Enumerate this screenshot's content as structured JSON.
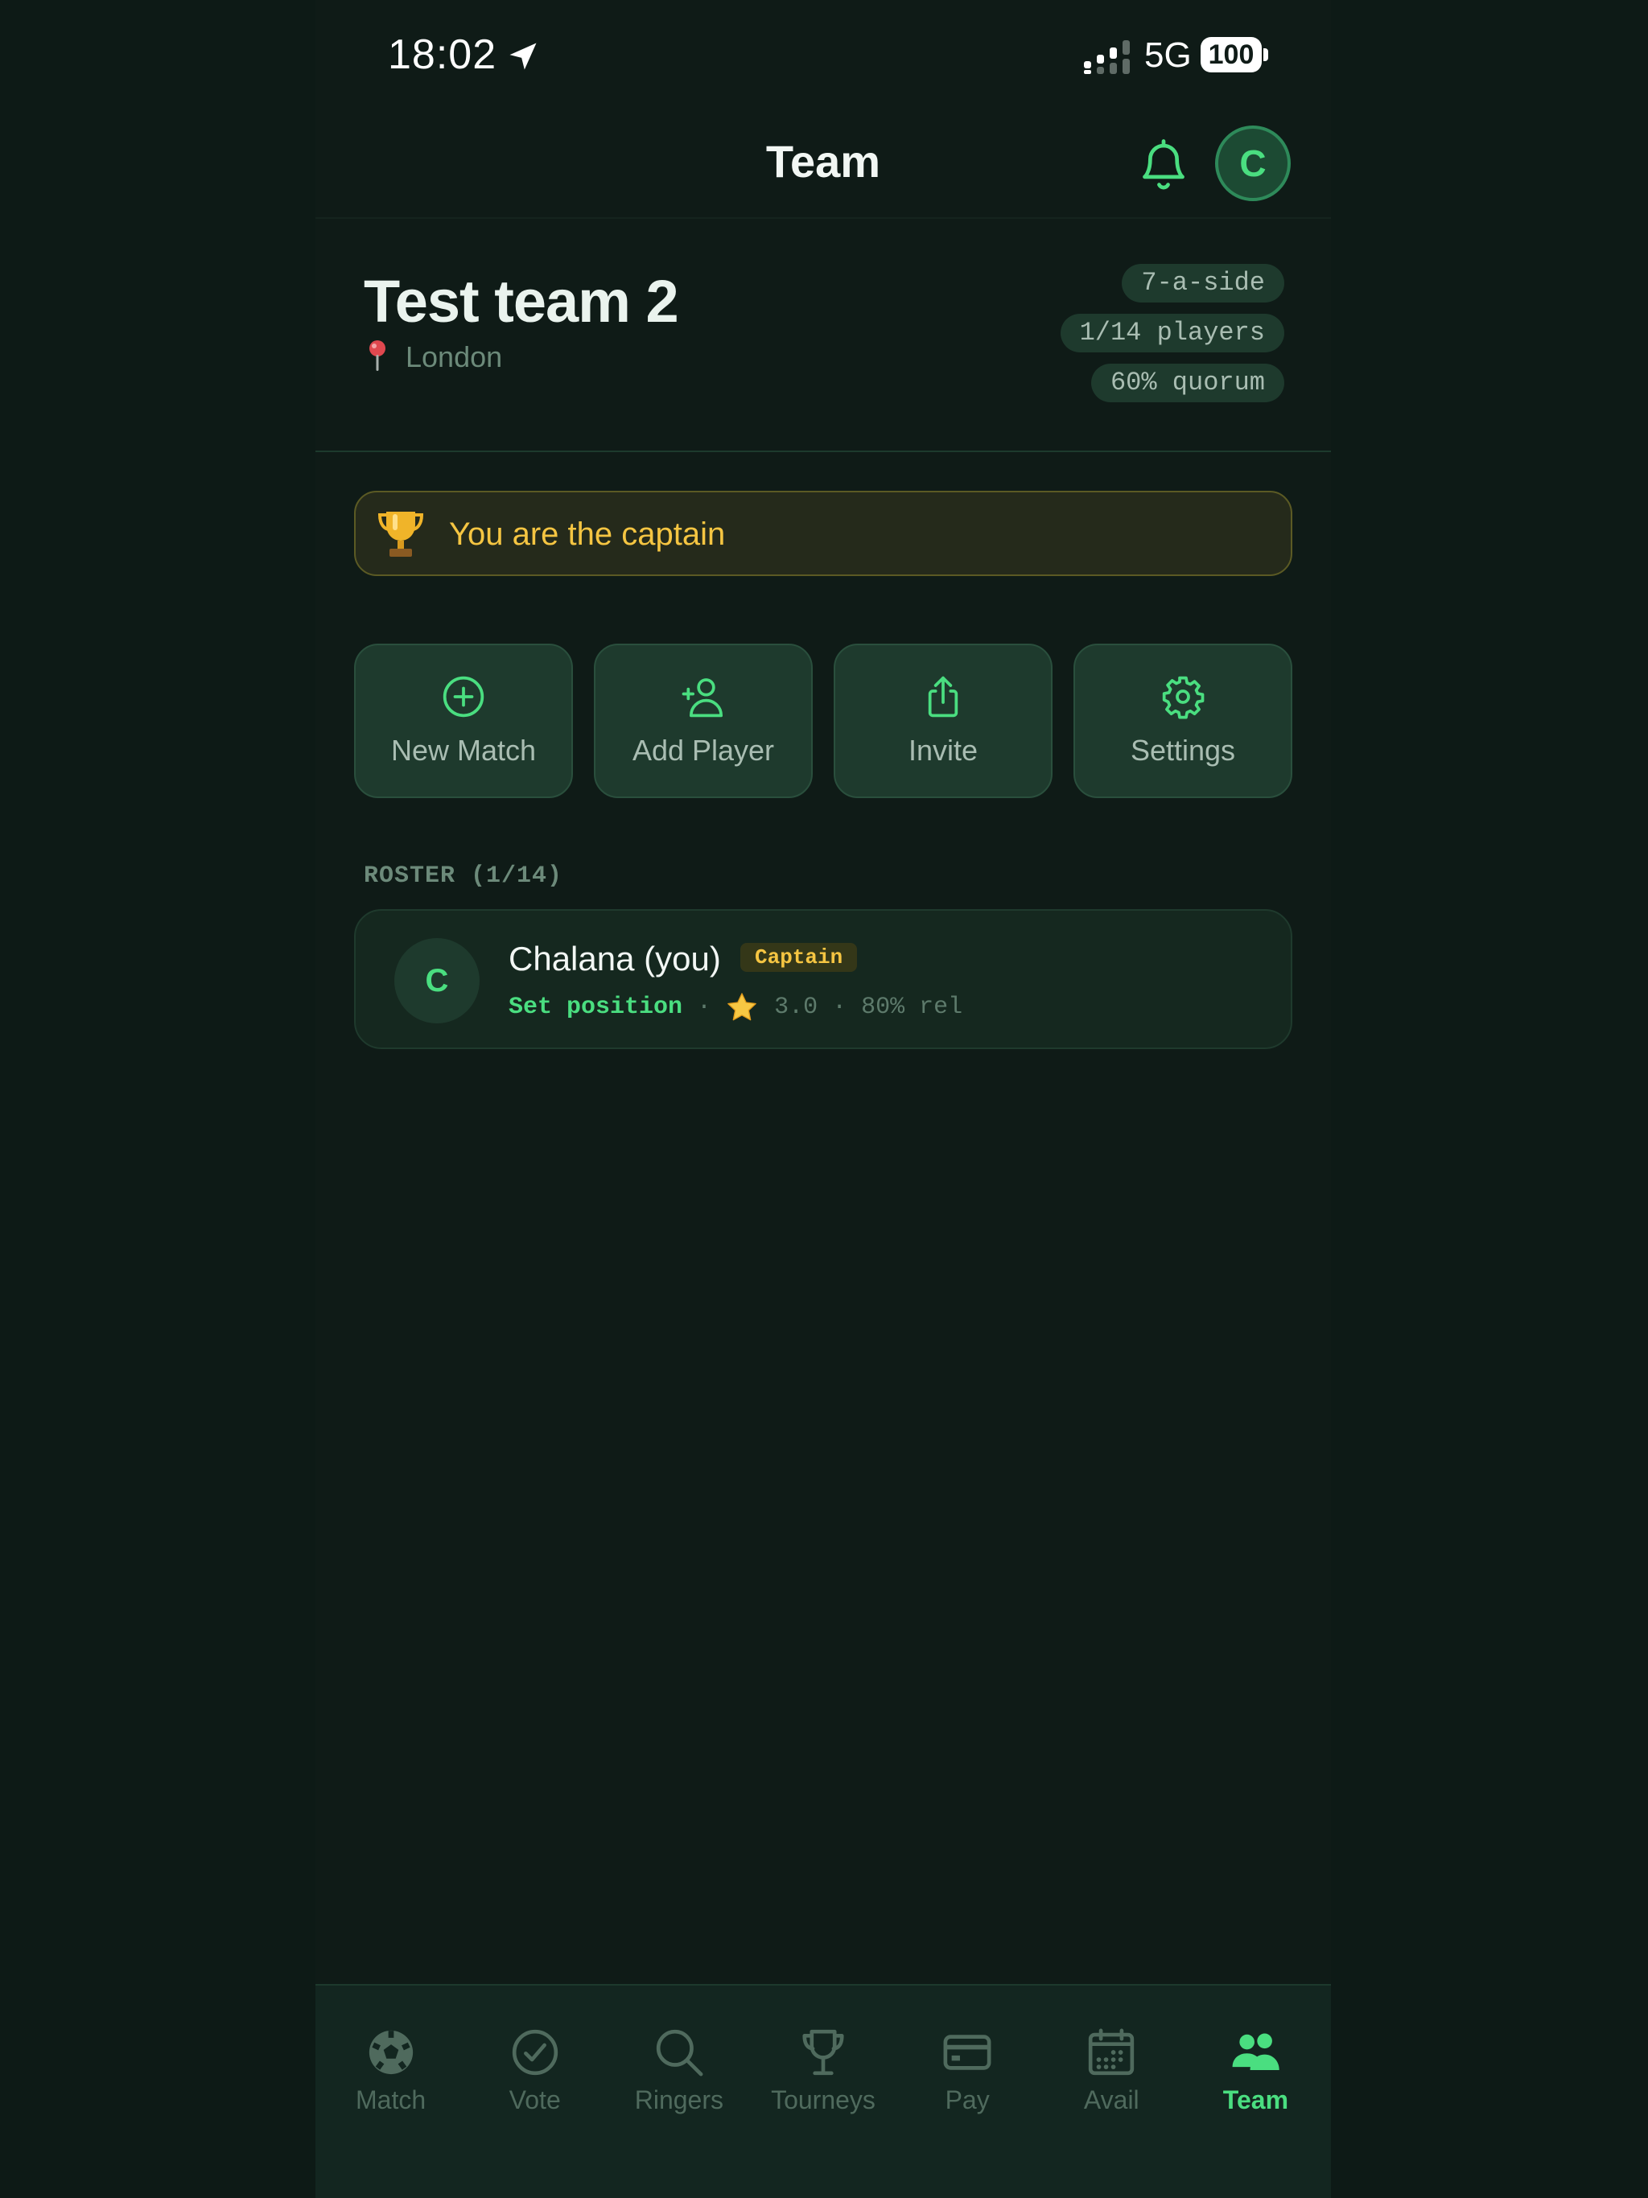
{
  "status_bar": {
    "time": "18:02",
    "network": "5G",
    "battery": "100"
  },
  "header": {
    "title": "Team",
    "avatar_initial": "C"
  },
  "team": {
    "name": "Test team 2",
    "location": "London",
    "chips": [
      "7-a-side",
      "1/14 players",
      "60% quorum"
    ]
  },
  "banner": {
    "text": "You are the captain"
  },
  "actions": [
    {
      "label": "New Match",
      "icon": "plus-circle-icon"
    },
    {
      "label": "Add Player",
      "icon": "user-plus-icon"
    },
    {
      "label": "Invite",
      "icon": "share-icon"
    },
    {
      "label": "Settings",
      "icon": "gear-icon"
    }
  ],
  "roster": {
    "heading": "ROSTER (1/14)",
    "players": [
      {
        "initial": "C",
        "name": "Chalana (you)",
        "badge": "Captain",
        "position": "Set position",
        "rating": "3.0",
        "reliability": "80% rel"
      }
    ]
  },
  "tabs": [
    {
      "label": "Match",
      "icon": "soccer-ball-icon"
    },
    {
      "label": "Vote",
      "icon": "check-circle-icon"
    },
    {
      "label": "Ringers",
      "icon": "search-icon"
    },
    {
      "label": "Tourneys",
      "icon": "trophy-icon"
    },
    {
      "label": "Pay",
      "icon": "card-icon"
    },
    {
      "label": "Avail",
      "icon": "calendar-icon"
    },
    {
      "label": "Team",
      "icon": "users-icon",
      "active": true
    }
  ],
  "colors": {
    "accent": "#4ade80",
    "gold": "#f5c542",
    "background": "#0f1b17",
    "card": "#1e3a2d"
  }
}
